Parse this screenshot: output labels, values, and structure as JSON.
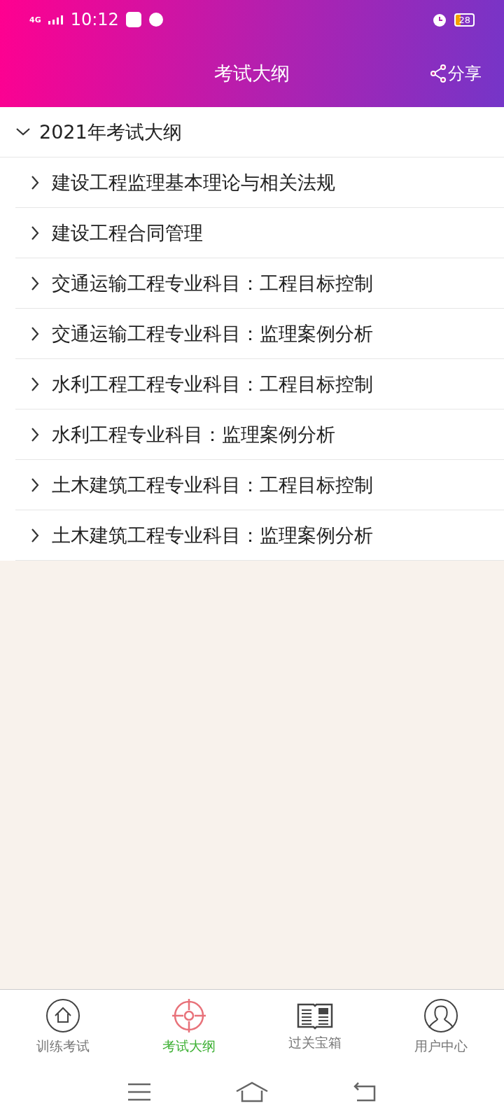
{
  "status_bar": {
    "network": "4G",
    "time": "10:12",
    "battery": "28"
  },
  "header": {
    "title": "考试大纲",
    "share": "分享"
  },
  "outline": [
    {
      "label": "2021年考试大纲",
      "expanded": true,
      "children": [
        {
          "label": "建设工程监理基本理论与相关法规",
          "expanded": false
        },
        {
          "label": "建设工程合同管理",
          "expanded": false
        },
        {
          "label": "交通运输工程专业科目：工程目标控制",
          "expanded": false
        },
        {
          "label": "交通运输工程专业科目：监理案例分析",
          "expanded": false
        },
        {
          "label": "水利工程工程专业科目：工程目标控制",
          "expanded": false
        },
        {
          "label": "水利工程专业科目：监理案例分析",
          "expanded": false
        },
        {
          "label": "土木建筑工程专业科目：工程目标控制",
          "expanded": false
        },
        {
          "label": "土木建筑工程专业科目：监理案例分析",
          "expanded": false
        }
      ]
    }
  ],
  "tabs": [
    {
      "label": "训练考试",
      "selected": false
    },
    {
      "label": "考试大纲",
      "selected": true
    },
    {
      "label": "过关宝箱",
      "selected": false
    },
    {
      "label": "用户中心",
      "selected": false
    }
  ]
}
